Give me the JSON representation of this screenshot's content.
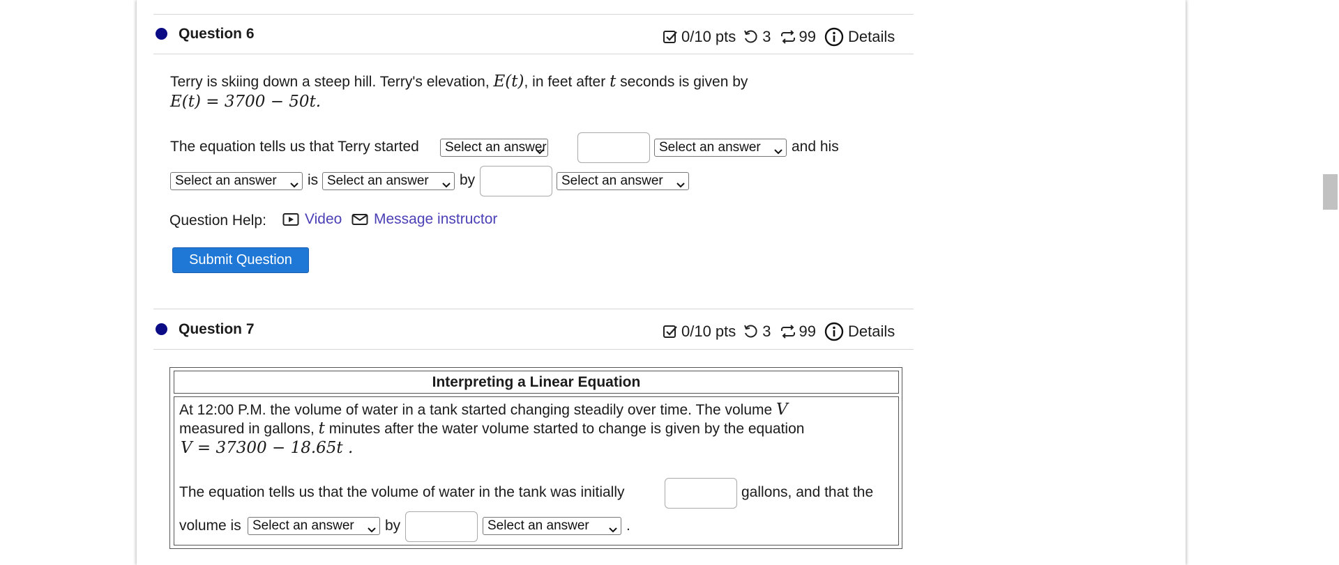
{
  "q6": {
    "title": "Question 6",
    "meta": {
      "pts": "0/10 pts",
      "tries": "3",
      "attempts": "99",
      "details": "Details"
    },
    "text1a": "Terry is skiing down a steep hill. Terry's elevation, ",
    "var_E": "E(t)",
    "text1b": ", in feet after ",
    "var_t": "t",
    "text1c": " seconds is given by",
    "equation": "E(t) = 3700 − 50t.",
    "sentence_a": "The equation tells us that Terry started",
    "sentence_b": "and his",
    "sentence_c": "is",
    "sentence_d": "by",
    "select_placeholder": "Select an answer",
    "help_label": "Question Help:",
    "video_label": "Video",
    "message_label": "Message instructor",
    "submit_label": "Submit Question"
  },
  "q7": {
    "title": "Question 7",
    "meta": {
      "pts": "0/10 pts",
      "tries": "3",
      "attempts": "99",
      "details": "Details"
    },
    "box_title": "Interpreting a Linear Equation",
    "line1a": "At 12:00 P.M. the volume of water in a tank started changing steadily over time. The volume ",
    "var_V": "V",
    "line2a": "measured in gallons, ",
    "var_t": "t",
    "line2b": " minutes after the water volume started to change is given by the equation",
    "equation": "V = 37300 − 18.65t .",
    "sentence_a": "The equation tells us that the volume of water in the tank was initially",
    "sentence_b": "gallons, and that the",
    "sentence_c": "volume is",
    "sentence_d": "by",
    "sentence_end": ".",
    "select_placeholder": "Select an answer"
  },
  "colors": {
    "status_dot": "#0b0b86",
    "link": "#4a3fb5",
    "button": "#1f78d6"
  }
}
